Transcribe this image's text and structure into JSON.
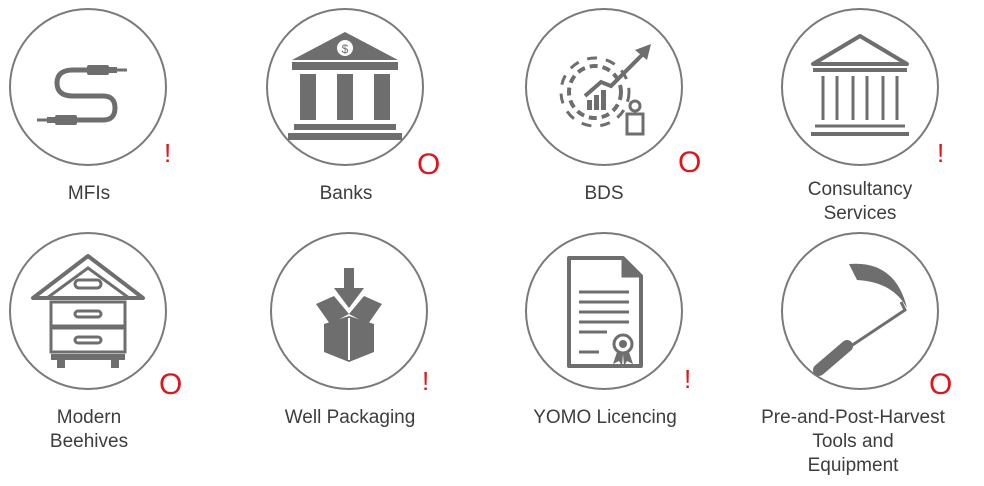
{
  "items": [
    {
      "label": "MFIs",
      "marker": "!",
      "icon": "cable-icon"
    },
    {
      "label": "Banks",
      "marker": "O",
      "icon": "bank-icon"
    },
    {
      "label": "BDS",
      "marker": "O",
      "icon": "growth-gear-icon"
    },
    {
      "label": "Consultancy\nServices",
      "marker": "!",
      "icon": "institution-icon"
    },
    {
      "label": "Modern\nBeehives",
      "marker": "O",
      "icon": "beehive-icon"
    },
    {
      "label": "Well Packaging",
      "marker": "!",
      "icon": "package-icon"
    },
    {
      "label": "YOMO Licencing",
      "marker": "!",
      "icon": "certificate-icon"
    },
    {
      "label": "Pre-and-Post-Harvest\nTools and\nEquipment",
      "marker": "O",
      "icon": "sickle-icon"
    }
  ],
  "colors": {
    "icon": "#6e6e6e",
    "ring": "#7a7a7a",
    "marker": "#e2141a",
    "text": "#3d3d3d"
  }
}
